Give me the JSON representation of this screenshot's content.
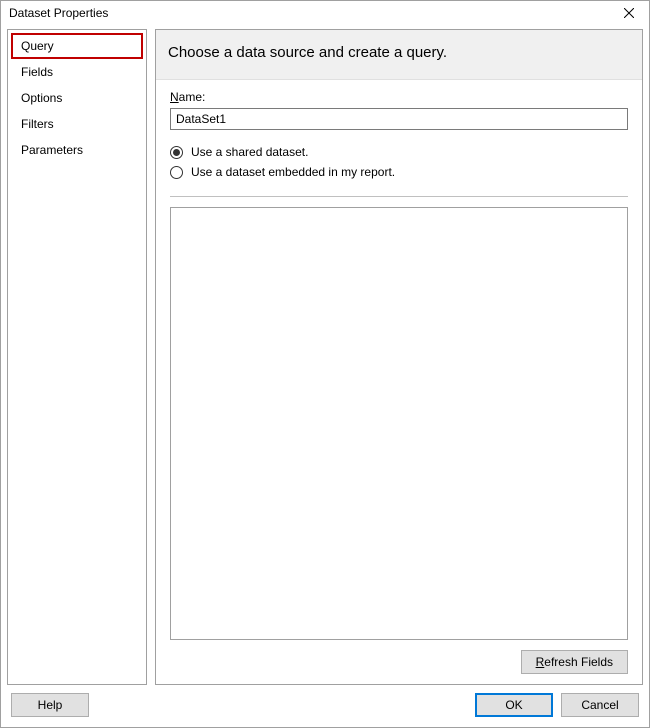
{
  "titlebar": {
    "title": "Dataset Properties"
  },
  "sidebar": {
    "items": [
      {
        "label": "Query",
        "selected": true
      },
      {
        "label": "Fields",
        "selected": false
      },
      {
        "label": "Options",
        "selected": false
      },
      {
        "label": "Filters",
        "selected": false
      },
      {
        "label": "Parameters",
        "selected": false
      }
    ]
  },
  "main": {
    "header": "Choose a data source and create a query.",
    "name_label_prefix": "N",
    "name_label_rest": "ame:",
    "name_value": "DataSet1",
    "radios": [
      {
        "label": "Use a shared dataset.",
        "checked": true
      },
      {
        "label": "Use a dataset embedded in my report.",
        "checked": false
      }
    ],
    "refresh_prefix": "R",
    "refresh_rest": "efresh Fields"
  },
  "footer": {
    "help": "Help",
    "ok": "OK",
    "cancel": "Cancel"
  }
}
